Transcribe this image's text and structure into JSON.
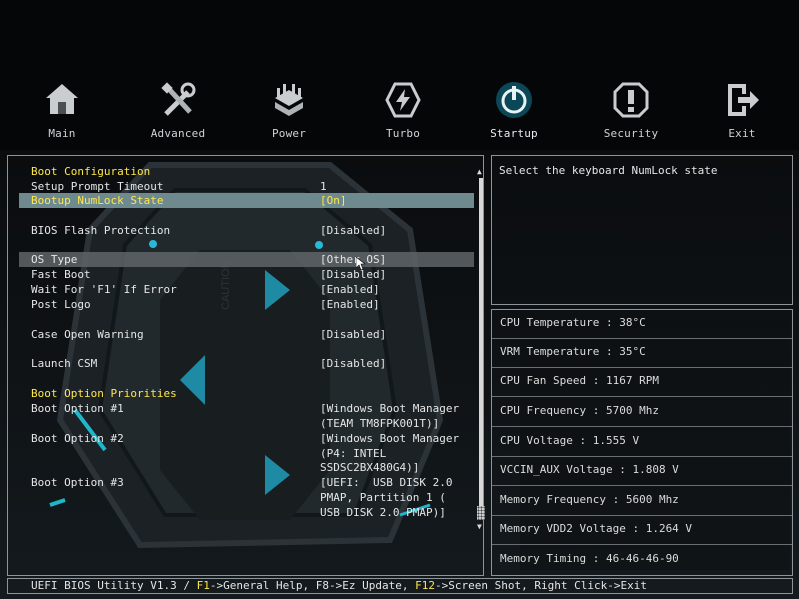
{
  "nav": {
    "tabs": [
      {
        "label": "Main",
        "icon": "home-icon",
        "active": false
      },
      {
        "label": "Advanced",
        "icon": "tools-icon",
        "active": false
      },
      {
        "label": "Power",
        "icon": "power-chip-icon",
        "active": false
      },
      {
        "label": "Turbo",
        "icon": "lightning-icon",
        "active": false
      },
      {
        "label": "Startup",
        "icon": "startup-power-icon",
        "active": true
      },
      {
        "label": "Security",
        "icon": "shield-icon",
        "active": false
      },
      {
        "label": "Exit",
        "icon": "exit-icon",
        "active": false
      }
    ]
  },
  "settings": {
    "boot_config_heading": "Boot Configuration",
    "setup_prompt_timeout": {
      "label": "Setup Prompt Timeout",
      "value": "1"
    },
    "bootup_numlock": {
      "label": "Bootup NumLock State",
      "value": "[On]"
    },
    "bios_flash_protection": {
      "label": "BIOS Flash Protection",
      "value": "[Disabled]"
    },
    "os_type": {
      "label": "OS Type",
      "value": "[Other OS]"
    },
    "fast_boot": {
      "label": "Fast Boot",
      "value": "[Disabled]"
    },
    "wait_f1": {
      "label": "Wait For 'F1' If Error",
      "value": "[Enabled]"
    },
    "post_logo": {
      "label": "Post Logo",
      "value": "[Enabled]"
    },
    "case_open_warning": {
      "label": "Case Open Warning",
      "value": "[Disabled]"
    },
    "launch_csm": {
      "label": "Launch CSM",
      "value": "[Disabled]"
    },
    "boot_priorities_heading": "Boot Option Priorities",
    "boot_option_1": {
      "label": "Boot Option #1",
      "lines": [
        "[Windows Boot Manager",
        "(TEAM TM8FPK001T)]"
      ]
    },
    "boot_option_2": {
      "label": "Boot Option #2",
      "lines": [
        "[Windows Boot Manager",
        "(P4: INTEL",
        "SSDSC2BX480G4)]"
      ]
    },
    "boot_option_3": {
      "label": "Boot Option #3",
      "lines": [
        "[UEFI:  USB DISK 2.0",
        "PMAP, Partition 1 (",
        "USB DISK 2.0 PMAP)]"
      ]
    }
  },
  "help": {
    "text": "Select the keyboard NumLock state"
  },
  "status": [
    "CPU Temperature : 38°C",
    "VRM Temperature : 35°C",
    "CPU Fan Speed : 1167 RPM",
    "CPU Frequency : 5700 Mhz",
    "CPU Voltage : 1.555 V",
    "VCCIN_AUX Voltage : 1.808 V",
    "Memory Frequency : 5600 Mhz",
    "Memory VDD2 Voltage : 1.264 V",
    "Memory Timing : 46-46-46-90"
  ],
  "footer": {
    "prefix": "UEFI BIOS Utility V1.3 / ",
    "f1_key": "F1",
    "f1_text": "->General Help, F8->Ez Update, ",
    "f12_key": "F12",
    "f12_text": "->Screen Shot, Right Click->Exit"
  },
  "colors": {
    "highlight": "#ffe84a",
    "selected_row": "#6f8a8f",
    "accent": "#1fb6c9"
  }
}
